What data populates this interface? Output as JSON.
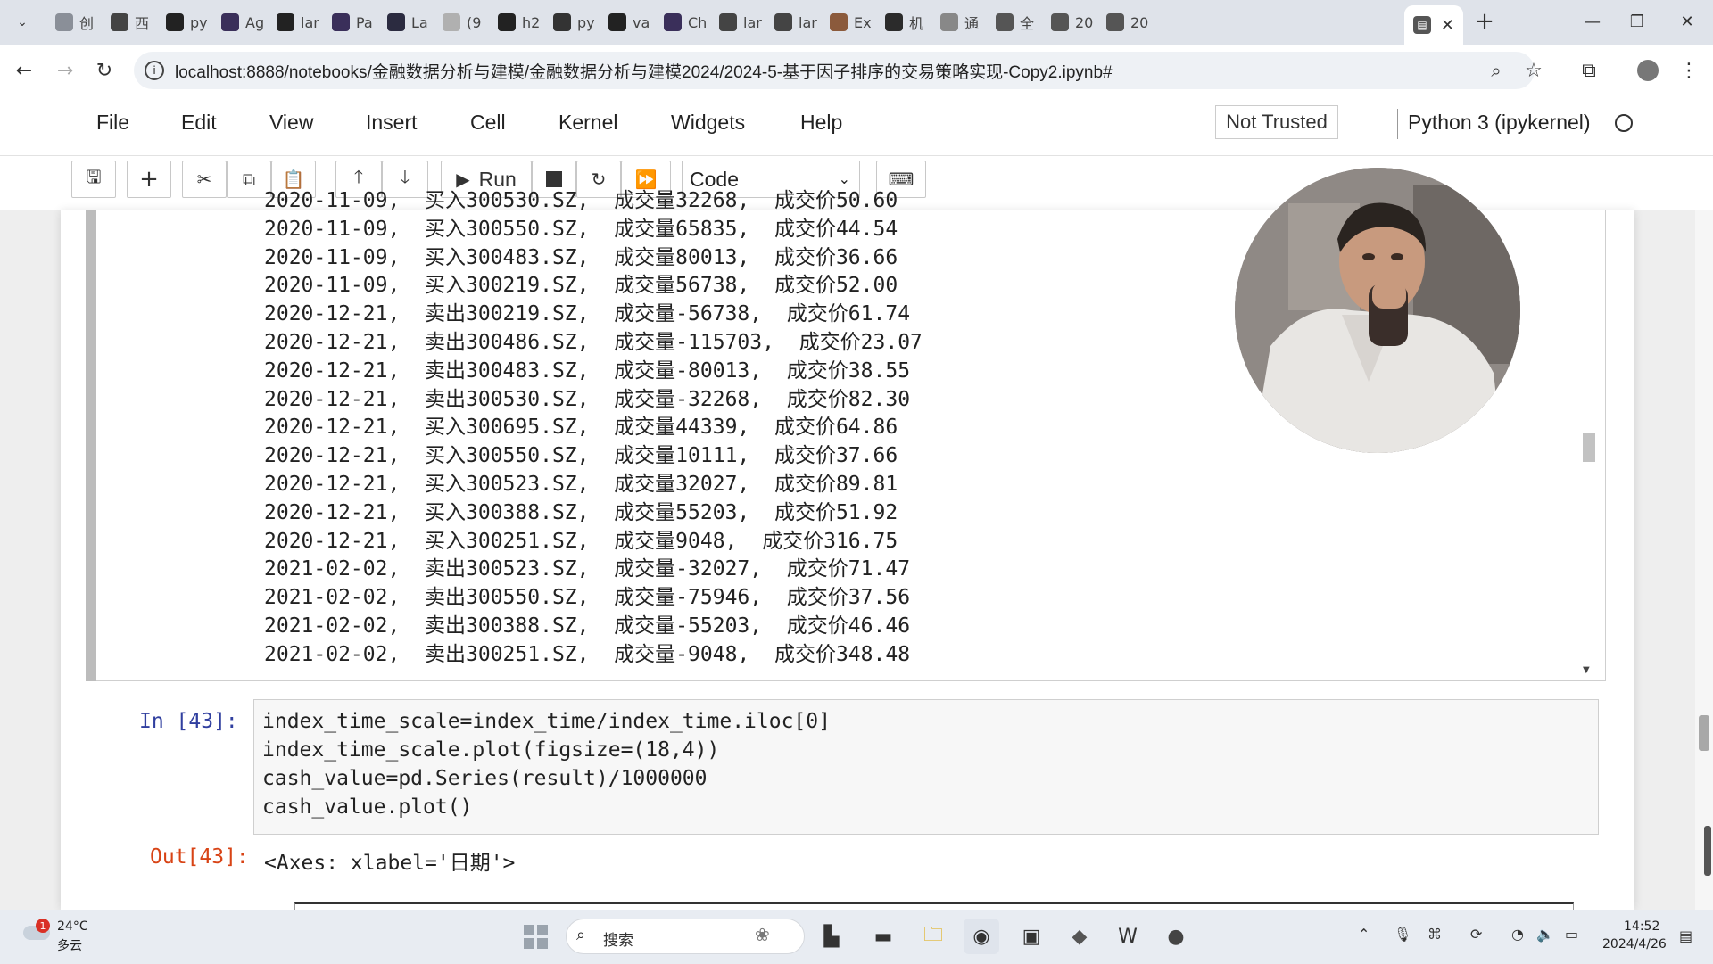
{
  "browser": {
    "tabs": [
      {
        "label": "创",
        "icon": "bookmark-icon",
        "color": "#8a8f98"
      },
      {
        "label": "西",
        "icon": "browser-icon",
        "color": "#444"
      },
      {
        "label": "py",
        "icon": "github-icon",
        "color": "#222"
      },
      {
        "label": "Ag",
        "icon": "mail-icon",
        "color": "#3a2f5a"
      },
      {
        "label": "lar",
        "icon": "github-icon",
        "color": "#222"
      },
      {
        "label": "Pa",
        "icon": "mail-icon",
        "color": "#3a2f5a"
      },
      {
        "label": "La",
        "icon": "terminal-icon",
        "color": "#2b2b40"
      },
      {
        "label": "(9",
        "icon": "document-icon",
        "color": "#b0b0b0"
      },
      {
        "label": "h2",
        "icon": "github-icon",
        "color": "#222"
      },
      {
        "label": "py",
        "icon": "code-icon",
        "color": "#333"
      },
      {
        "label": "va",
        "icon": "github-icon",
        "color": "#222"
      },
      {
        "label": "Ch",
        "icon": "mail-icon",
        "color": "#3a2f5a"
      },
      {
        "label": "lar",
        "icon": "book-icon",
        "color": "#444"
      },
      {
        "label": "lar",
        "icon": "book-icon",
        "color": "#444"
      },
      {
        "label": "Ex",
        "icon": "person-icon",
        "color": "#8b5a3c"
      },
      {
        "label": "机",
        "icon": "paper-icon",
        "color": "#2b2b2b"
      },
      {
        "label": "通",
        "icon": "translate-icon",
        "color": "#888"
      },
      {
        "label": "全",
        "icon": "loading-icon",
        "color": "#555"
      },
      {
        "label": "20",
        "icon": "notebook-icon",
        "color": "#555"
      },
      {
        "label": "20",
        "icon": "notebook-icon",
        "color": "#555"
      }
    ],
    "url": "localhost:8888/notebooks/金融数据分析与建模/金融数据分析与建模2024/2024-5-基于因子排序的交易策略实现-Copy2.ipynb#"
  },
  "jupyter": {
    "menu": [
      "File",
      "Edit",
      "View",
      "Insert",
      "Cell",
      "Kernel",
      "Widgets",
      "Help"
    ],
    "trust_status": "Not Trusted",
    "kernel": "Python 3 (ipykernel)",
    "run_label": "Run",
    "cell_type": "Code"
  },
  "output_lines": [
    "2020-11-09,  买入300530.SZ,  成交量32268,  成交价50.60",
    "2020-11-09,  买入300550.SZ,  成交量65835,  成交价44.54",
    "2020-11-09,  买入300483.SZ,  成交量80013,  成交价36.66",
    "2020-11-09,  买入300219.SZ,  成交量56738,  成交价52.00",
    "2020-12-21,  卖出300219.SZ,  成交量-56738,  成交价61.74",
    "2020-12-21,  卖出300486.SZ,  成交量-115703,  成交价23.07",
    "2020-12-21,  卖出300483.SZ,  成交量-80013,  成交价38.55",
    "2020-12-21,  卖出300530.SZ,  成交量-32268,  成交价82.30",
    "2020-12-21,  买入300695.SZ,  成交量44339,  成交价64.86",
    "2020-12-21,  买入300550.SZ,  成交量10111,  成交价37.66",
    "2020-12-21,  买入300523.SZ,  成交量32027,  成交价89.81",
    "2020-12-21,  买入300388.SZ,  成交量55203,  成交价51.92",
    "2020-12-21,  买入300251.SZ,  成交量9048,  成交价316.75",
    "2021-02-02,  卖出300523.SZ,  成交量-32027,  成交价71.47",
    "2021-02-02,  卖出300550.SZ,  成交量-75946,  成交价37.56",
    "2021-02-02,  卖出300388.SZ,  成交量-55203,  成交价46.46",
    "2021-02-02,  卖出300251.SZ,  成交量-9048,  成交价348.48"
  ],
  "cell": {
    "in_prompt": "In  [43]:",
    "code": [
      "index_time_scale=index_time/index_time.iloc[0]",
      "index_time_scale.plot(figsize=(18,4))",
      "cash_value=pd.Series(result)/1000000",
      "cash_value.plot()"
    ],
    "out_prompt": "Out[43]:",
    "out_text": "<Axes: xlabel='日期'>"
  },
  "taskbar": {
    "weather_badge": "1",
    "temperature": "24°C",
    "condition": "多云",
    "search_placeholder": "搜索",
    "time": "14:52",
    "date": "2024/4/26"
  }
}
